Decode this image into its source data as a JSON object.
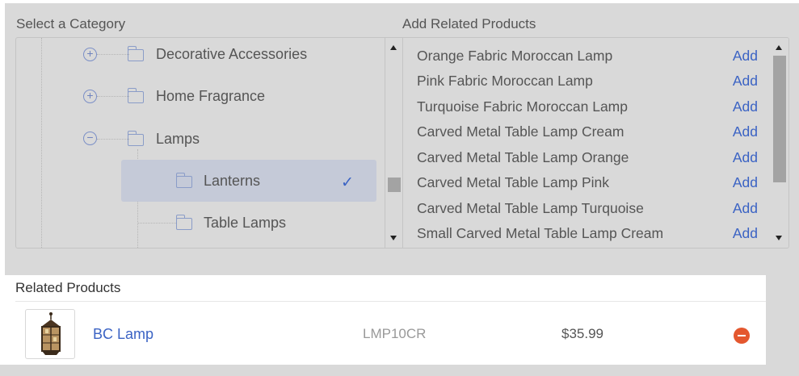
{
  "category_section": {
    "label": "Select a Category",
    "tree": [
      {
        "label": "Decorative Accessories",
        "toggle": "+",
        "expanded": false
      },
      {
        "label": "Home Fragrance",
        "toggle": "+",
        "expanded": false
      },
      {
        "label": "Lamps",
        "toggle": "−",
        "expanded": true
      },
      {
        "label": "Lanterns",
        "selected": true
      },
      {
        "label": "Table Lamps"
      }
    ],
    "selected_icon": "check-icon"
  },
  "products_section": {
    "label": "Add Related Products",
    "add_label": "Add",
    "items": [
      "Orange Fabric Moroccan Lamp",
      "Pink Fabric Moroccan Lamp",
      "Turquoise Fabric Moroccan Lamp",
      "Carved Metal Table Lamp Cream",
      "Carved Metal Table Lamp Orange",
      "Carved Metal Table Lamp Pink",
      "Carved Metal Table Lamp Turquoise",
      "Small Carved Metal Table Lamp Cream"
    ]
  },
  "related_section": {
    "label": "Related Products",
    "items": [
      {
        "name": "BC Lamp",
        "sku": "LMP10CR",
        "price": "$35.99",
        "remove_icon": "minus-circle-icon"
      }
    ]
  },
  "colors": {
    "accent": "#3b63c4",
    "overlay": "#d9d9d9",
    "danger": "#e4572e",
    "selected_bg": "#c5cad8"
  }
}
